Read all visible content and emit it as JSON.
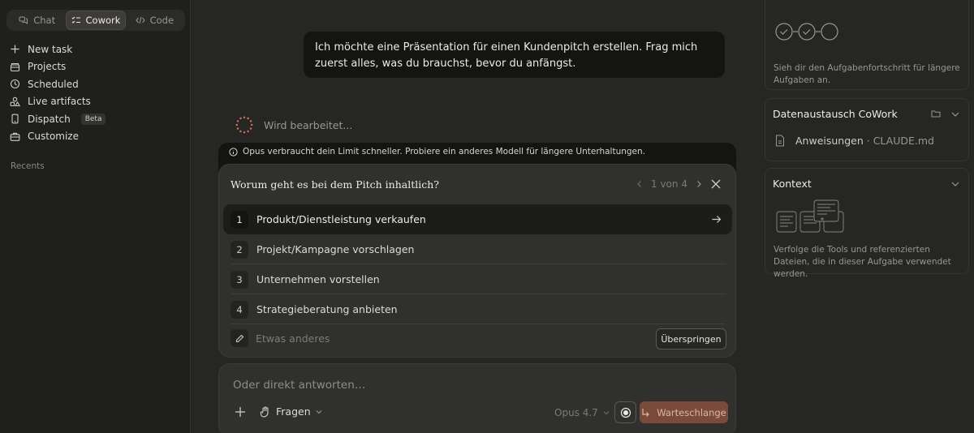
{
  "sidebar": {
    "modes": [
      {
        "label": "Chat",
        "icon": "chat-bubbles-icon"
      },
      {
        "label": "Cowork",
        "icon": "checklist-icon",
        "active": true
      },
      {
        "label": "Code",
        "icon": "code-icon"
      }
    ],
    "nav": [
      {
        "label": "New task",
        "icon": "plus-icon"
      },
      {
        "label": "Projects",
        "icon": "folder-box-icon"
      },
      {
        "label": "Scheduled",
        "icon": "clock-icon"
      },
      {
        "label": "Live artifacts",
        "icon": "shapes-icon"
      },
      {
        "label": "Dispatch",
        "icon": "phone-icon",
        "badge": "Beta"
      },
      {
        "label": "Customize",
        "icon": "briefcase-icon"
      }
    ],
    "recents_label": "Recents"
  },
  "chat": {
    "user_message": "Ich möchte eine Präsentation für einen Kundenpitch erstellen. Frag mich zuerst alles, was du brauchst, bevor du anfängst.",
    "status": "Wird bearbeitet..."
  },
  "limit_notice": "Opus verbraucht dein Limit schneller. Probiere ein anderes Modell für längere Unterhaltungen.",
  "question": {
    "title": "Worum geht es bei dem Pitch inhaltlich?",
    "pager": "1 von 4",
    "options": [
      {
        "num": "1",
        "label": "Produkt/Dienstleistung verkaufen"
      },
      {
        "num": "2",
        "label": "Projekt/Kampagne vorschlagen"
      },
      {
        "num": "3",
        "label": "Unternehmen vorstellen"
      },
      {
        "num": "4",
        "label": "Strategieberatung anbieten"
      }
    ],
    "other_placeholder": "Etwas anderes",
    "skip_label": "Überspringen"
  },
  "composer": {
    "placeholder": "Oder direkt antworten…",
    "mode_label": "Fragen",
    "model_label": "Opus 4.7",
    "queue_label": "Warteschlange"
  },
  "right_panel": {
    "progress_text": "Sieh dir den Aufgabenfortschritt für längere Aufgaben an.",
    "exchange_title": "Datenaustausch CoWork",
    "file_name": "Anweisungen",
    "file_sub": "· CLAUDE.md",
    "context_title": "Kontext",
    "context_text": "Verfolge die Tools und referenzierten Dateien, die in dieser Aufgabe verwendet werden."
  },
  "colors": {
    "background": "#262624",
    "sidebar": "#1f1f1e",
    "card": "#30302e",
    "accent_button": "#7a4b3a",
    "spinner": "#d97757"
  }
}
